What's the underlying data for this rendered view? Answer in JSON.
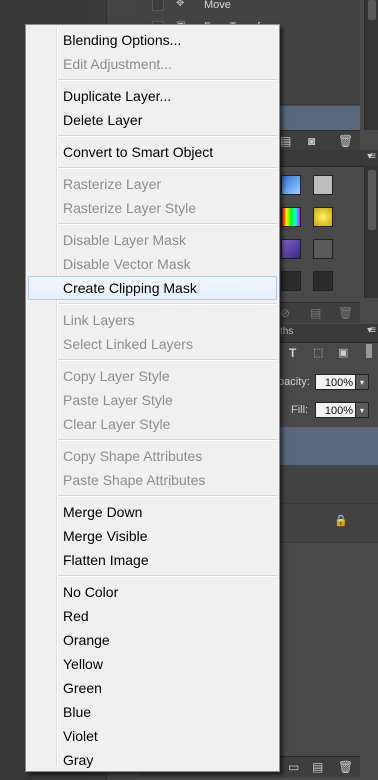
{
  "history_panel": {
    "items": [
      {
        "label": "Move"
      },
      {
        "label": "Free Transform"
      }
    ]
  },
  "layers_panel": {
    "tab_label": "ths",
    "opacity_label": "pacity:",
    "opacity_value": "100%",
    "fill_label": "Fill:",
    "fill_value": "100%"
  },
  "context_menu": {
    "items": [
      {
        "label": "Blending Options...",
        "enabled": true
      },
      {
        "label": "Edit Adjustment...",
        "enabled": false
      },
      {
        "label": "Duplicate Layer...",
        "enabled": true
      },
      {
        "label": "Delete Layer",
        "enabled": true
      },
      {
        "label": "Convert to Smart Object",
        "enabled": true
      },
      {
        "label": "Rasterize Layer",
        "enabled": false
      },
      {
        "label": "Rasterize Layer Style",
        "enabled": false
      },
      {
        "label": "Disable Layer Mask",
        "enabled": false
      },
      {
        "label": "Disable Vector Mask",
        "enabled": false
      },
      {
        "label": "Create Clipping Mask",
        "enabled": true,
        "highlighted": true
      },
      {
        "label": "Link Layers",
        "enabled": false
      },
      {
        "label": "Select Linked Layers",
        "enabled": false
      },
      {
        "label": "Copy Layer Style",
        "enabled": false
      },
      {
        "label": "Paste Layer Style",
        "enabled": false
      },
      {
        "label": "Clear Layer Style",
        "enabled": false
      },
      {
        "label": "Copy Shape Attributes",
        "enabled": false
      },
      {
        "label": "Paste Shape Attributes",
        "enabled": false
      },
      {
        "label": "Merge Down",
        "enabled": true
      },
      {
        "label": "Merge Visible",
        "enabled": true
      },
      {
        "label": "Flatten Image",
        "enabled": true
      },
      {
        "label": "No Color",
        "enabled": true
      },
      {
        "label": "Red",
        "enabled": true
      },
      {
        "label": "Orange",
        "enabled": true
      },
      {
        "label": "Yellow",
        "enabled": true
      },
      {
        "label": "Green",
        "enabled": true
      },
      {
        "label": "Blue",
        "enabled": true
      },
      {
        "label": "Violet",
        "enabled": true
      },
      {
        "label": "Gray",
        "enabled": true
      }
    ]
  },
  "colors": {
    "menu_background": "#f0f0f0",
    "menu_text": "#000000",
    "menu_disabled_text": "#8d8d8d",
    "highlight_border": "#aeccf1",
    "panel_background": "#494949",
    "selection_blue": "#59677c"
  }
}
